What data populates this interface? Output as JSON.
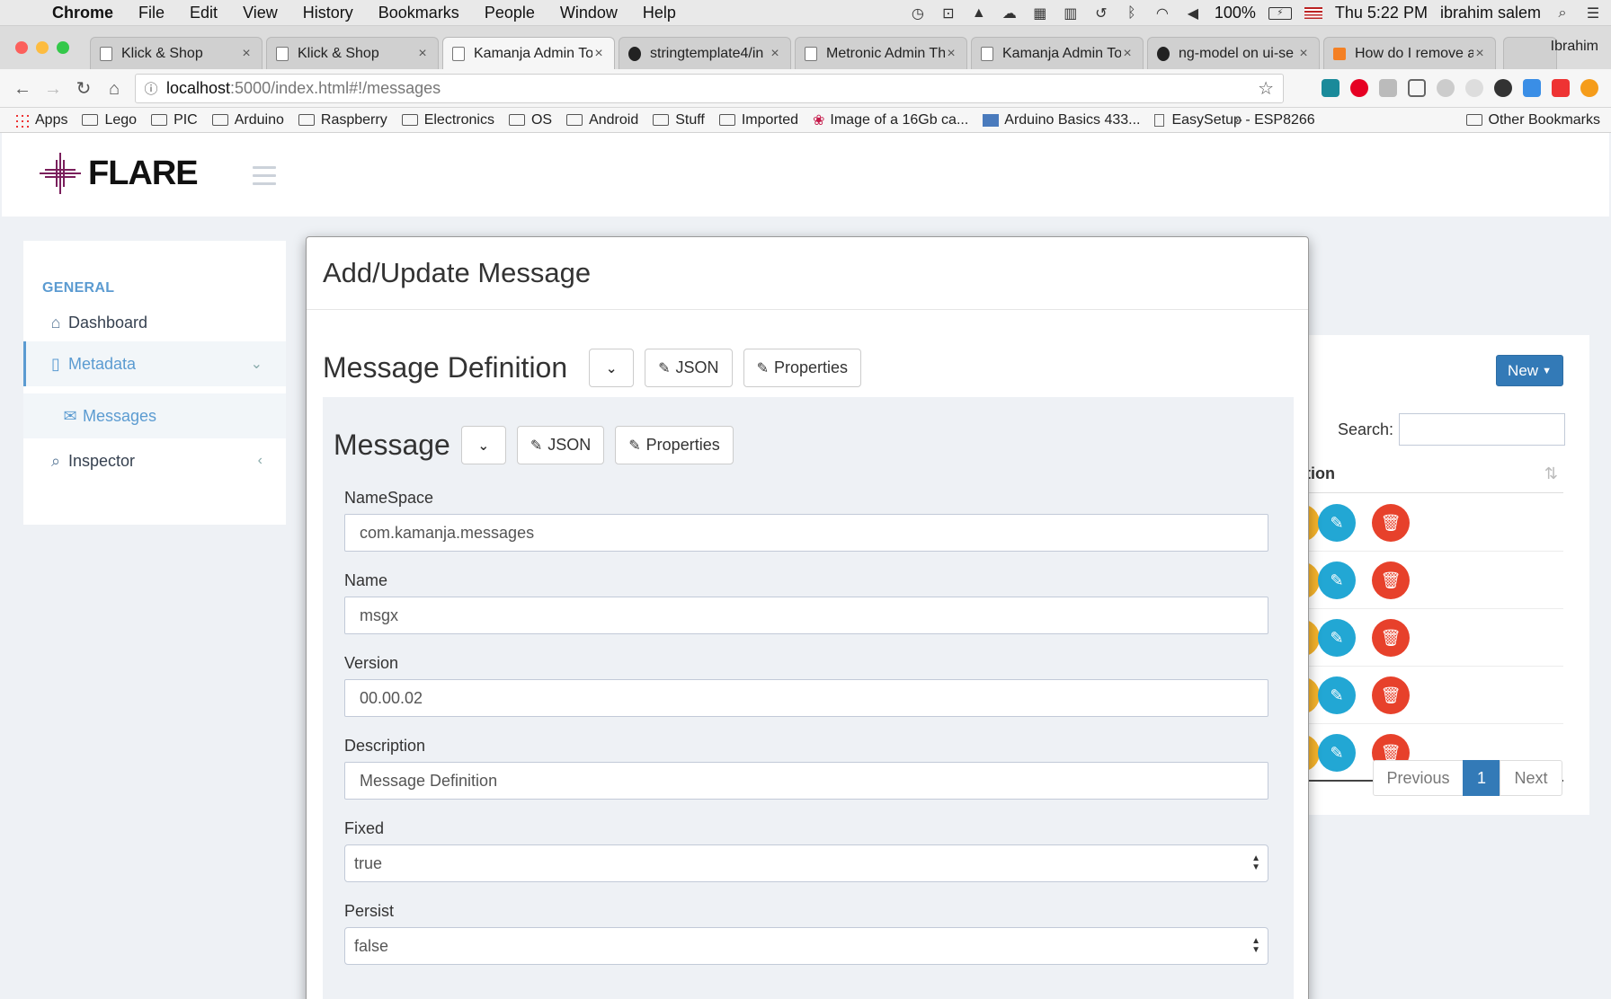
{
  "mac_menubar": {
    "app_name": "Chrome",
    "menus": [
      "File",
      "Edit",
      "View",
      "History",
      "Bookmarks",
      "People",
      "Window",
      "Help"
    ],
    "battery": "100%",
    "clock": "Thu 5:22 PM",
    "user": "ibrahim salem"
  },
  "tabs": [
    {
      "title": "Klick & Shop",
      "active": false
    },
    {
      "title": "Klick & Shop",
      "active": false
    },
    {
      "title": "Kamanja Admin To",
      "active": true
    },
    {
      "title": "stringtemplate4/in",
      "active": false
    },
    {
      "title": "Metronic Admin Th",
      "active": false
    },
    {
      "title": "Kamanja Admin To",
      "active": false
    },
    {
      "title": "ng-model on ui-se",
      "active": false
    },
    {
      "title": "How do I remove a",
      "active": false
    }
  ],
  "profile_name": "Ibrahim",
  "address_bar": {
    "host": "localhost",
    "path": ":5000/index.html#!/messages"
  },
  "bookmarks": {
    "apps": "Apps",
    "items": [
      "Lego",
      "PIC",
      "Arduino",
      "Raspberry",
      "Electronics",
      "OS",
      "Android",
      "Stuff",
      "Imported",
      "Image of a 16Gb ca...",
      "Arduino Basics 433...",
      "EasySetup - ESP8266"
    ],
    "more": "»",
    "other": "Other Bookmarks"
  },
  "app": {
    "logo_text": "FLARE"
  },
  "sidebar": {
    "section": "GENERAL",
    "items": [
      {
        "label": "Dashboard",
        "icon": "home-icon"
      },
      {
        "label": "Metadata",
        "icon": "file-icon"
      },
      {
        "label": "Messages",
        "icon": "envelope-icon"
      },
      {
        "label": "Inspector",
        "icon": "search-icon"
      }
    ]
  },
  "list_panel": {
    "new_label": "New",
    "search_label": "Search:",
    "column_header": "ction",
    "row_count": 5,
    "pager": {
      "previous": "Previous",
      "current": "1",
      "next": "Next"
    }
  },
  "modal": {
    "title": "Add/Update Message",
    "definition_heading": "Message Definition",
    "json_label": "JSON",
    "properties_label": "Properties",
    "message_heading": "Message",
    "fields": {
      "namespace": {
        "label": "NameSpace",
        "value": "com.kamanja.messages"
      },
      "name": {
        "label": "Name",
        "value": "msgx"
      },
      "version": {
        "label": "Version",
        "value": "00.00.02"
      },
      "description": {
        "label": "Description",
        "value": "Message Definition"
      },
      "fixed": {
        "label": "Fixed",
        "value": "true"
      },
      "persist": {
        "label": "Persist",
        "value": "false"
      }
    }
  },
  "colors": {
    "accent": "#5b9bd1",
    "primary_button": "#337ab7",
    "view_button": "#f5b32b",
    "edit_button": "#22a7d4",
    "delete_button": "#e7412b"
  }
}
